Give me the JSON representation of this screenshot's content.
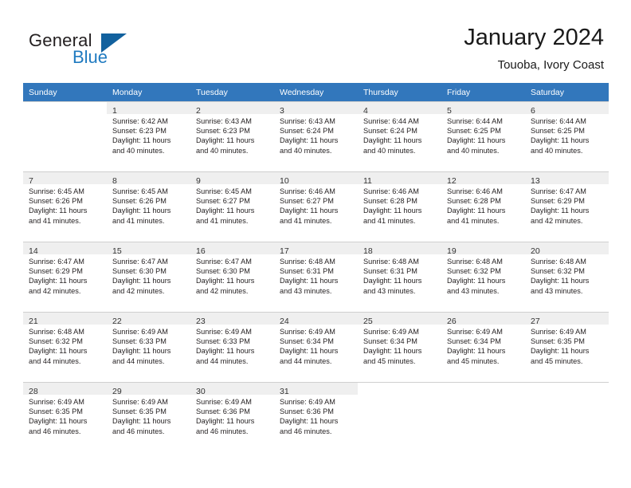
{
  "brand": {
    "word1": "General",
    "word2": "Blue",
    "triangle_color": "#12619e",
    "blue_color": "#1f7ac0"
  },
  "header": {
    "title": "January 2024",
    "subtitle": "Touoba, Ivory Coast"
  },
  "calendar": {
    "header_bg": "#3277bc",
    "weekday_headers": [
      "Sunday",
      "Monday",
      "Tuesday",
      "Wednesday",
      "Thursday",
      "Friday",
      "Saturday"
    ],
    "weeks": [
      [
        {
          "day": "",
          "lines": []
        },
        {
          "day": "1",
          "lines": [
            "Sunrise: 6:42 AM",
            "Sunset: 6:23 PM",
            "Daylight: 11 hours",
            "and 40 minutes."
          ]
        },
        {
          "day": "2",
          "lines": [
            "Sunrise: 6:43 AM",
            "Sunset: 6:23 PM",
            "Daylight: 11 hours",
            "and 40 minutes."
          ]
        },
        {
          "day": "3",
          "lines": [
            "Sunrise: 6:43 AM",
            "Sunset: 6:24 PM",
            "Daylight: 11 hours",
            "and 40 minutes."
          ]
        },
        {
          "day": "4",
          "lines": [
            "Sunrise: 6:44 AM",
            "Sunset: 6:24 PM",
            "Daylight: 11 hours",
            "and 40 minutes."
          ]
        },
        {
          "day": "5",
          "lines": [
            "Sunrise: 6:44 AM",
            "Sunset: 6:25 PM",
            "Daylight: 11 hours",
            "and 40 minutes."
          ]
        },
        {
          "day": "6",
          "lines": [
            "Sunrise: 6:44 AM",
            "Sunset: 6:25 PM",
            "Daylight: 11 hours",
            "and 40 minutes."
          ]
        }
      ],
      [
        {
          "day": "7",
          "lines": [
            "Sunrise: 6:45 AM",
            "Sunset: 6:26 PM",
            "Daylight: 11 hours",
            "and 41 minutes."
          ]
        },
        {
          "day": "8",
          "lines": [
            "Sunrise: 6:45 AM",
            "Sunset: 6:26 PM",
            "Daylight: 11 hours",
            "and 41 minutes."
          ]
        },
        {
          "day": "9",
          "lines": [
            "Sunrise: 6:45 AM",
            "Sunset: 6:27 PM",
            "Daylight: 11 hours",
            "and 41 minutes."
          ]
        },
        {
          "day": "10",
          "lines": [
            "Sunrise: 6:46 AM",
            "Sunset: 6:27 PM",
            "Daylight: 11 hours",
            "and 41 minutes."
          ]
        },
        {
          "day": "11",
          "lines": [
            "Sunrise: 6:46 AM",
            "Sunset: 6:28 PM",
            "Daylight: 11 hours",
            "and 41 minutes."
          ]
        },
        {
          "day": "12",
          "lines": [
            "Sunrise: 6:46 AM",
            "Sunset: 6:28 PM",
            "Daylight: 11 hours",
            "and 41 minutes."
          ]
        },
        {
          "day": "13",
          "lines": [
            "Sunrise: 6:47 AM",
            "Sunset: 6:29 PM",
            "Daylight: 11 hours",
            "and 42 minutes."
          ]
        }
      ],
      [
        {
          "day": "14",
          "lines": [
            "Sunrise: 6:47 AM",
            "Sunset: 6:29 PM",
            "Daylight: 11 hours",
            "and 42 minutes."
          ]
        },
        {
          "day": "15",
          "lines": [
            "Sunrise: 6:47 AM",
            "Sunset: 6:30 PM",
            "Daylight: 11 hours",
            "and 42 minutes."
          ]
        },
        {
          "day": "16",
          "lines": [
            "Sunrise: 6:47 AM",
            "Sunset: 6:30 PM",
            "Daylight: 11 hours",
            "and 42 minutes."
          ]
        },
        {
          "day": "17",
          "lines": [
            "Sunrise: 6:48 AM",
            "Sunset: 6:31 PM",
            "Daylight: 11 hours",
            "and 43 minutes."
          ]
        },
        {
          "day": "18",
          "lines": [
            "Sunrise: 6:48 AM",
            "Sunset: 6:31 PM",
            "Daylight: 11 hours",
            "and 43 minutes."
          ]
        },
        {
          "day": "19",
          "lines": [
            "Sunrise: 6:48 AM",
            "Sunset: 6:32 PM",
            "Daylight: 11 hours",
            "and 43 minutes."
          ]
        },
        {
          "day": "20",
          "lines": [
            "Sunrise: 6:48 AM",
            "Sunset: 6:32 PM",
            "Daylight: 11 hours",
            "and 43 minutes."
          ]
        }
      ],
      [
        {
          "day": "21",
          "lines": [
            "Sunrise: 6:48 AM",
            "Sunset: 6:32 PM",
            "Daylight: 11 hours",
            "and 44 minutes."
          ]
        },
        {
          "day": "22",
          "lines": [
            "Sunrise: 6:49 AM",
            "Sunset: 6:33 PM",
            "Daylight: 11 hours",
            "and 44 minutes."
          ]
        },
        {
          "day": "23",
          "lines": [
            "Sunrise: 6:49 AM",
            "Sunset: 6:33 PM",
            "Daylight: 11 hours",
            "and 44 minutes."
          ]
        },
        {
          "day": "24",
          "lines": [
            "Sunrise: 6:49 AM",
            "Sunset: 6:34 PM",
            "Daylight: 11 hours",
            "and 44 minutes."
          ]
        },
        {
          "day": "25",
          "lines": [
            "Sunrise: 6:49 AM",
            "Sunset: 6:34 PM",
            "Daylight: 11 hours",
            "and 45 minutes."
          ]
        },
        {
          "day": "26",
          "lines": [
            "Sunrise: 6:49 AM",
            "Sunset: 6:34 PM",
            "Daylight: 11 hours",
            "and 45 minutes."
          ]
        },
        {
          "day": "27",
          "lines": [
            "Sunrise: 6:49 AM",
            "Sunset: 6:35 PM",
            "Daylight: 11 hours",
            "and 45 minutes."
          ]
        }
      ],
      [
        {
          "day": "28",
          "lines": [
            "Sunrise: 6:49 AM",
            "Sunset: 6:35 PM",
            "Daylight: 11 hours",
            "and 46 minutes."
          ]
        },
        {
          "day": "29",
          "lines": [
            "Sunrise: 6:49 AM",
            "Sunset: 6:35 PM",
            "Daylight: 11 hours",
            "and 46 minutes."
          ]
        },
        {
          "day": "30",
          "lines": [
            "Sunrise: 6:49 AM",
            "Sunset: 6:36 PM",
            "Daylight: 11 hours",
            "and 46 minutes."
          ]
        },
        {
          "day": "31",
          "lines": [
            "Sunrise: 6:49 AM",
            "Sunset: 6:36 PM",
            "Daylight: 11 hours",
            "and 46 minutes."
          ]
        },
        {
          "day": "",
          "lines": []
        },
        {
          "day": "",
          "lines": []
        },
        {
          "day": "",
          "lines": []
        }
      ]
    ]
  }
}
